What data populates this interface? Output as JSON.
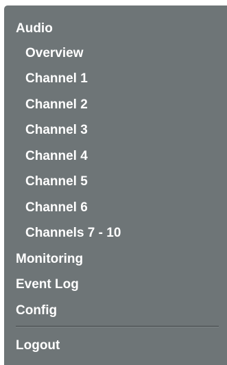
{
  "nav": {
    "audio": "Audio",
    "audio_children": [
      "Overview",
      "Channel 1",
      "Channel 2",
      "Channel 3",
      "Channel 4",
      "Channel 5",
      "Channel 6",
      "Channels 7 - 10"
    ],
    "monitoring": "Monitoring",
    "event_log": "Event Log",
    "config": "Config",
    "logout": "Logout"
  }
}
